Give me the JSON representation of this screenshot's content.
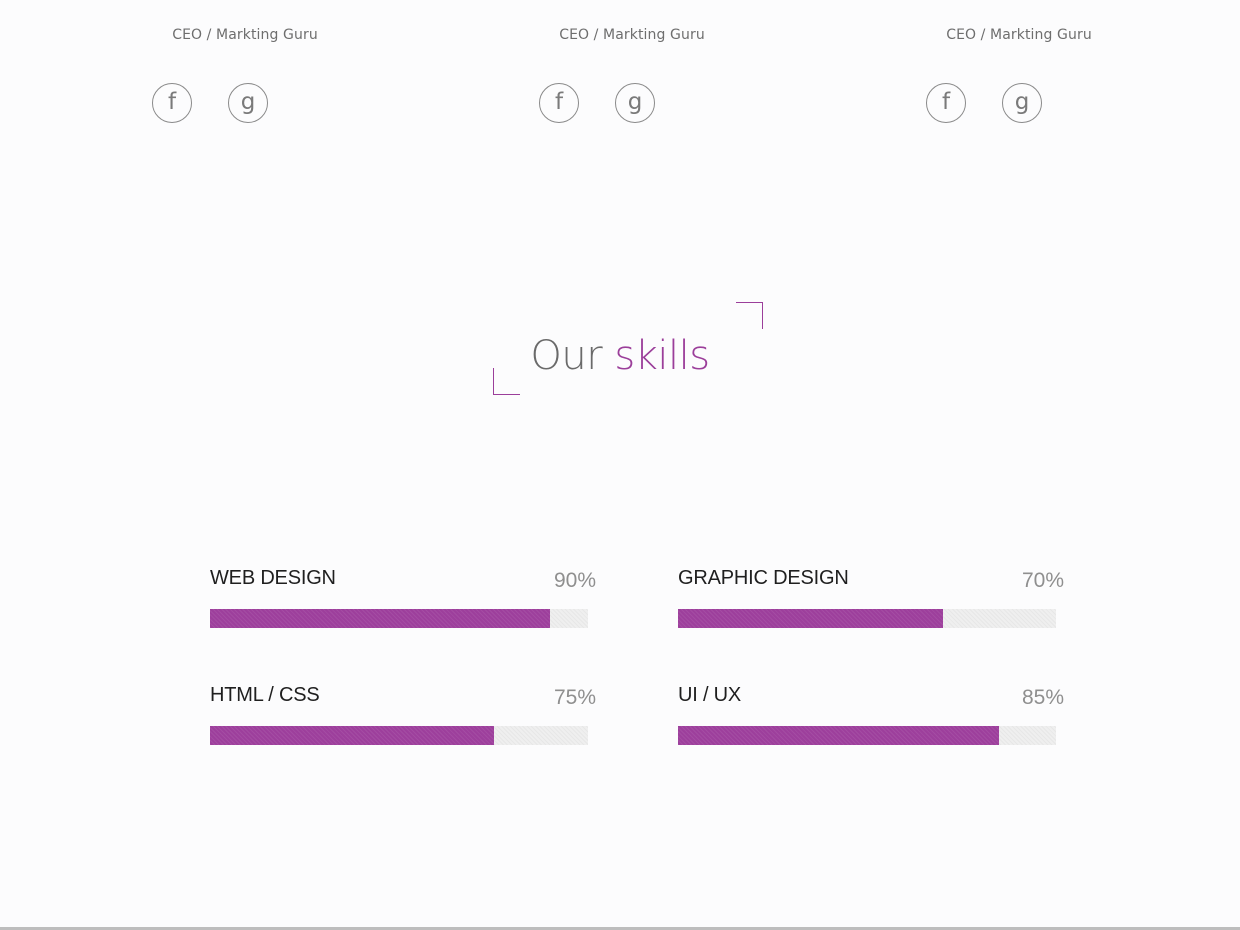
{
  "team": [
    {
      "role": "CEO / Markting Guru",
      "facebook_glyph": "f",
      "google_glyph": "g"
    },
    {
      "role": "CEO / Markting Guru",
      "facebook_glyph": "f",
      "google_glyph": "g"
    },
    {
      "role": "CEO / Markting Guru",
      "facebook_glyph": "f",
      "google_glyph": "g"
    }
  ],
  "skills_section": {
    "heading_word1": "Our",
    "heading_word2": "skills",
    "accent_color": "#9b3e9a"
  },
  "skills": [
    {
      "name": "WEB DESIGN",
      "percent_label": "90%",
      "level": 0.9
    },
    {
      "name": "GRAPHIC DESIGN",
      "percent_label": "70%",
      "level": 0.7
    },
    {
      "name": "HTML / CSS",
      "percent_label": "75%",
      "level": 0.75
    },
    {
      "name": "UI / UX",
      "percent_label": "85%",
      "level": 0.85
    }
  ]
}
